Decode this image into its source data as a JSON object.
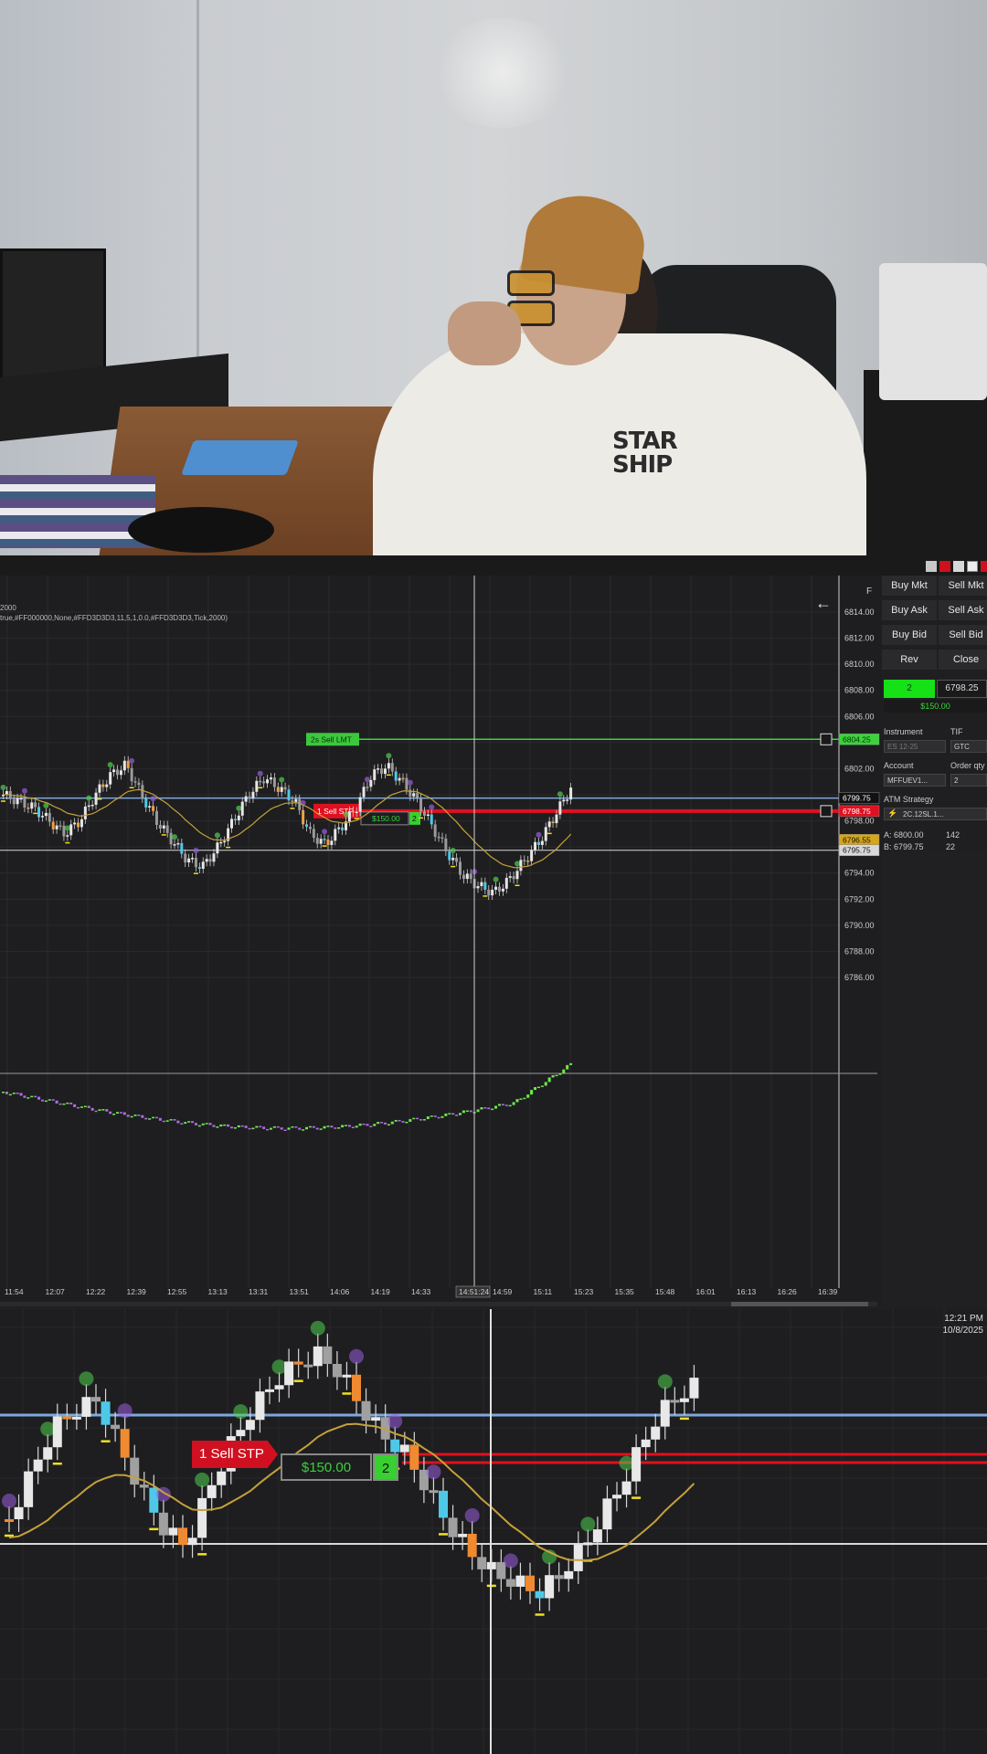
{
  "webcam": {
    "hoodie_text": "STAR\nSHIP"
  },
  "chart1": {
    "params_line1": "2000",
    "params_line2": "true,#FF000000,None,#FFD3D3D3,11,5,1,0.0,#FFD3D3D3,Tick,2000)",
    "f_label": "F",
    "price_axis": [
      "6814.00",
      "6812.00",
      "6810.00",
      "6808.00",
      "6806.00",
      "6802.00",
      "6798.00",
      "6794.00",
      "6792.00",
      "6790.00",
      "6788.00",
      "6786.00"
    ],
    "price_markers": {
      "sell_lmt": "6804.25",
      "last": "6799.75",
      "sell_stop": "6798.75",
      "avg": "6796.55",
      "white_line": "6795.75"
    },
    "time_axis": [
      "11:54",
      "12:07",
      "12:22",
      "12:39",
      "12:55",
      "13:13",
      "13:31",
      "13:51",
      "14:06",
      "14:19",
      "14:33",
      "14:51:24",
      "14:59",
      "15:11",
      "15:23",
      "15:35",
      "15:48",
      "16:01",
      "16:13",
      "16:26",
      "16:39"
    ],
    "sell_lmt_label": "2s  Sell LMT",
    "sell_stp_label": "1  Sell STP",
    "pnl_label": "$150.00",
    "qty_label": "2",
    "colors": {
      "buy_bar": "#6ee84f",
      "sell_bar": "#b06ee0",
      "sell_line": "#e01020",
      "target_line": "#3ad43a",
      "last_line": "#7fa8e0",
      "ema": "#c5a13a"
    }
  },
  "order_panel": {
    "buttons": {
      "buy_mkt": "Buy Mkt",
      "sell_mkt": "Sell Mkt",
      "buy_ask": "Buy Ask",
      "sell_ask": "Sell Ask",
      "buy_bid": "Buy Bid",
      "sell_bid": "Sell Bid",
      "rev": "Rev",
      "close": "Close"
    },
    "position_qty": "2",
    "position_price": "6798.25",
    "pnl": "$150.00",
    "instrument_label": "Instrument",
    "instrument_value": "ES 12-25",
    "tif_label": "TIF",
    "tif_value": "GTC",
    "account_label": "Account",
    "account_value": "MFFUEV1...",
    "order_qty_label": "Order qty",
    "order_qty_value": "2",
    "atm_label": "ATM Strategy",
    "atm_value": "2C.12SL.1...",
    "ask_line": "A: 6800.00",
    "ask_size": "142",
    "bid_line": "B: 6799.75",
    "bid_size": "22"
  },
  "chart2": {
    "clock_time": "12:21 PM",
    "clock_date": "10/8/2025",
    "sell_stp_label": "1  Sell STP",
    "pnl_label": "$150.00",
    "qty_label": "2"
  }
}
